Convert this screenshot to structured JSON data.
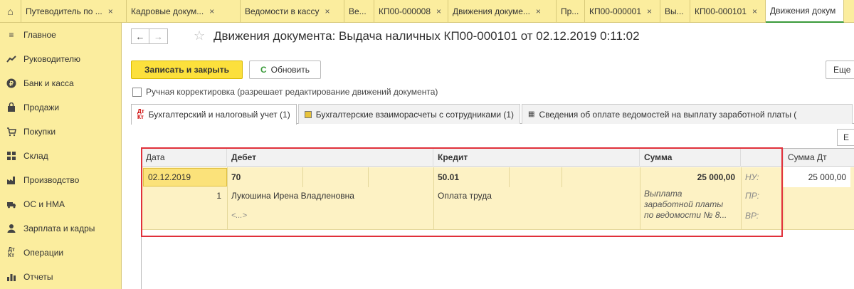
{
  "tabs": {
    "home_icon": "home-icon",
    "items": [
      {
        "label": "Путеводитель по ...",
        "closable": true,
        "width": 148
      },
      {
        "label": "Кадровые докум...",
        "closable": true,
        "width": 160
      },
      {
        "label": "Ведомости в кассу",
        "closable": true,
        "width": 146
      },
      {
        "label": "Ве...",
        "closable": false,
        "width": 42
      },
      {
        "label": "КП00-000008",
        "closable": true,
        "width": 104
      },
      {
        "label": "Движения докуме...",
        "closable": true,
        "width": 152
      },
      {
        "label": "Пр...",
        "closable": false,
        "width": 40
      },
      {
        "label": "КП00-000001",
        "closable": true,
        "width": 106
      },
      {
        "label": "Вы...",
        "closable": false,
        "width": 42
      },
      {
        "label": "КП00-000101",
        "closable": true,
        "width": 106
      },
      {
        "label": "Движения докум",
        "closable": false,
        "width": 110,
        "active": true
      }
    ]
  },
  "sidebar": {
    "items": [
      {
        "label": "Главное",
        "icon": "menu-lines-icon"
      },
      {
        "label": "Руководителю",
        "icon": "trend-icon"
      },
      {
        "label": "Банк и касса",
        "icon": "ruble-icon"
      },
      {
        "label": "Продажи",
        "icon": "bag-icon"
      },
      {
        "label": "Покупки",
        "icon": "cart-icon"
      },
      {
        "label": "Склад",
        "icon": "warehouse-icon"
      },
      {
        "label": "Производство",
        "icon": "factory-icon"
      },
      {
        "label": "ОС и НМА",
        "icon": "truck-icon"
      },
      {
        "label": "Зарплата и кадры",
        "icon": "person-icon"
      },
      {
        "label": "Операции",
        "icon": "dtkt-icon"
      },
      {
        "label": "Отчеты",
        "icon": "bar-chart-icon"
      }
    ]
  },
  "header": {
    "title": "Движения документа: Выдача наличных КП00-000101 от 02.12.2019 0:11:02"
  },
  "toolbar": {
    "save_close": "Записать и закрыть",
    "refresh": "Обновить",
    "more": "Еще"
  },
  "manual_correction": {
    "label": "Ручная корректировка (разрешает редактирование движений документа)",
    "checked": false
  },
  "subtabs": [
    {
      "label": "Бухгалтерский и налоговый учет (1)",
      "icon": "dtkt-icon",
      "active": true
    },
    {
      "label": "Бухгалтерские взаиморасчеты с сотрудниками (1)",
      "icon": "register-icon",
      "active": false
    },
    {
      "label": "Сведения об оплате ведомостей на выплату заработной платы (",
      "icon": "table-icon",
      "active": false
    }
  ],
  "grid_button": "Е",
  "table": {
    "headers": {
      "date": "Дата",
      "debit": "Дебет",
      "credit": "Кредит",
      "sum": "Сумма",
      "sum_dt": "Сумма Дт"
    },
    "row": {
      "date": "02.12.2019",
      "num": "1",
      "debit_account": "70",
      "debit_subconto1": "Лукошина Ирена Владленовна",
      "debit_subconto2": "<...>",
      "credit_account": "50.01",
      "credit_subconto1": "Оплата труда",
      "sum": "25 000,00",
      "content_line1": "Выплата",
      "content_line2": "заработной платы",
      "content_line3": "по ведомости № 8...",
      "nu_label": "НУ:",
      "pr_label": "ПР:",
      "vr_label": "ВР:",
      "sum_dt": "25 000,00"
    }
  }
}
